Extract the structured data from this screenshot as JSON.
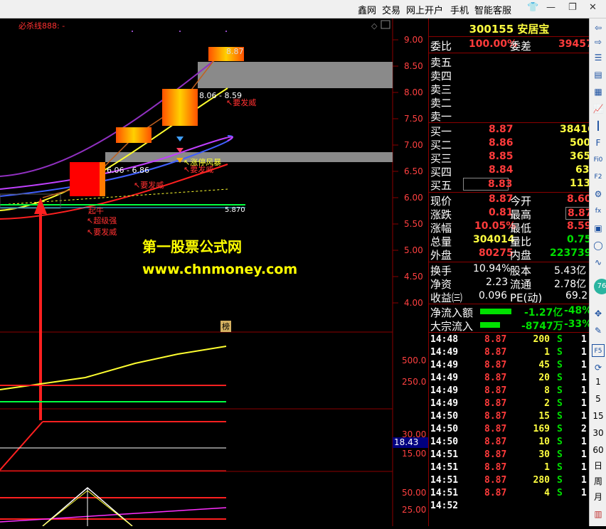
{
  "menu": {
    "items": [
      "鑫网",
      "交易",
      "网上开户",
      "手机",
      "智能客服"
    ]
  },
  "window": {
    "controls": [
      "shirt-icon",
      "minimize-icon",
      "restore-icon",
      "close-icon"
    ]
  },
  "chart": {
    "indicator_label": "必杀线888: -",
    "price_axis": [
      "9.00",
      "8.50",
      "8.00",
      "7.50",
      "7.00",
      "6.50",
      "6.00",
      "5.50",
      "5.00",
      "4.50",
      "4.00"
    ],
    "sub1_axis": [
      "500.0",
      "250.0"
    ],
    "sub2_axis": [
      "30.00",
      "15.00"
    ],
    "sub2_value": "18.43",
    "sub3_axis": [
      "50.00",
      "25.00"
    ],
    "annotations": {
      "a1": "8.87",
      "a2": "8.06 - 8.59",
      "a3": "6.06 - 6.86",
      "a4": "↖要发威",
      "a5": "↖要发威",
      "a6": "↖要发威",
      "a7": "↖涨停风暴",
      "a8": "起牛",
      "a9": "↖超级强",
      "a10": "↖要发威",
      "a11": "5.870",
      "a12": "榜"
    },
    "watermark1": "第一股票公式网",
    "watermark2": "www.chnmoney.com"
  },
  "quote": {
    "code": "300155",
    "name": "安居宝",
    "weibi_label": "委比",
    "weibi": "100.00%",
    "weicha_label": "委差",
    "weicha": "39457",
    "sells": [
      {
        "label": "卖五"
      },
      {
        "label": "卖四"
      },
      {
        "label": "卖三"
      },
      {
        "label": "卖二"
      },
      {
        "label": "卖一"
      }
    ],
    "buys": [
      {
        "label": "买一",
        "price": "8.87",
        "vol": "38416"
      },
      {
        "label": "买二",
        "price": "8.86",
        "vol": "500"
      },
      {
        "label": "买三",
        "price": "8.85",
        "vol": "365"
      },
      {
        "label": "买四",
        "price": "8.84",
        "vol": "63"
      },
      {
        "label": "买五",
        "price": "8.83",
        "vol": "113"
      }
    ],
    "stats": [
      {
        "l": "现价",
        "v": "8.87",
        "l2": "今开",
        "v2": "8.60"
      },
      {
        "l": "涨跌",
        "v": "0.81",
        "l2": "最高",
        "v2": "8.87"
      },
      {
        "l": "涨幅",
        "v": "10.05%",
        "l2": "最低",
        "v2": "8.59"
      },
      {
        "l": "总量",
        "v": "304014",
        "l2": "量比",
        "v2": "0.75"
      },
      {
        "l": "外盘",
        "v": "80275",
        "l2": "内盘",
        "v2": "223739"
      }
    ],
    "fin": [
      {
        "l": "换手",
        "v": "10.94%",
        "l2": "股本",
        "v2": "5.43亿"
      },
      {
        "l": "净资",
        "v": "2.23",
        "l2": "流通",
        "v2": "2.78亿"
      },
      {
        "l": "收益㈢",
        "v": "0.096",
        "l2": "PE(动)",
        "v2": "69.2"
      }
    ],
    "flows": [
      {
        "l": "净流入额",
        "v": "-1.27亿",
        "p": "-48%"
      },
      {
        "l": "大宗流入",
        "v": "-8747万",
        "p": "-33%"
      }
    ],
    "ticks": [
      {
        "t": "14:48",
        "p": "8.87",
        "v": "200",
        "s": "S",
        "n": "1"
      },
      {
        "t": "14:49",
        "p": "8.87",
        "v": "1",
        "s": "S",
        "n": "1"
      },
      {
        "t": "14:49",
        "p": "8.87",
        "v": "45",
        "s": "S",
        "n": "1"
      },
      {
        "t": "14:49",
        "p": "8.87",
        "v": "20",
        "s": "S",
        "n": "1"
      },
      {
        "t": "14:49",
        "p": "8.87",
        "v": "8",
        "s": "S",
        "n": "1"
      },
      {
        "t": "14:49",
        "p": "8.87",
        "v": "2",
        "s": "S",
        "n": "1"
      },
      {
        "t": "14:50",
        "p": "8.87",
        "v": "15",
        "s": "S",
        "n": "1"
      },
      {
        "t": "14:50",
        "p": "8.87",
        "v": "169",
        "s": "S",
        "n": "2"
      },
      {
        "t": "14:50",
        "p": "8.87",
        "v": "10",
        "s": "S",
        "n": "1"
      },
      {
        "t": "14:51",
        "p": "8.87",
        "v": "30",
        "s": "S",
        "n": "1"
      },
      {
        "t": "14:51",
        "p": "8.87",
        "v": "1",
        "s": "S",
        "n": "1"
      },
      {
        "t": "14:51",
        "p": "8.87",
        "v": "280",
        "s": "S",
        "n": "1"
      },
      {
        "t": "14:51",
        "p": "8.87",
        "v": "4",
        "s": "S",
        "n": "1"
      },
      {
        "t": "14:52",
        "p": "",
        "v": "",
        "s": "",
        "n": ""
      }
    ]
  },
  "side": {
    "labels": [
      "F5",
      "1",
      "5",
      "15",
      "30",
      "60",
      "日",
      "周",
      "月"
    ],
    "badge": "76"
  }
}
